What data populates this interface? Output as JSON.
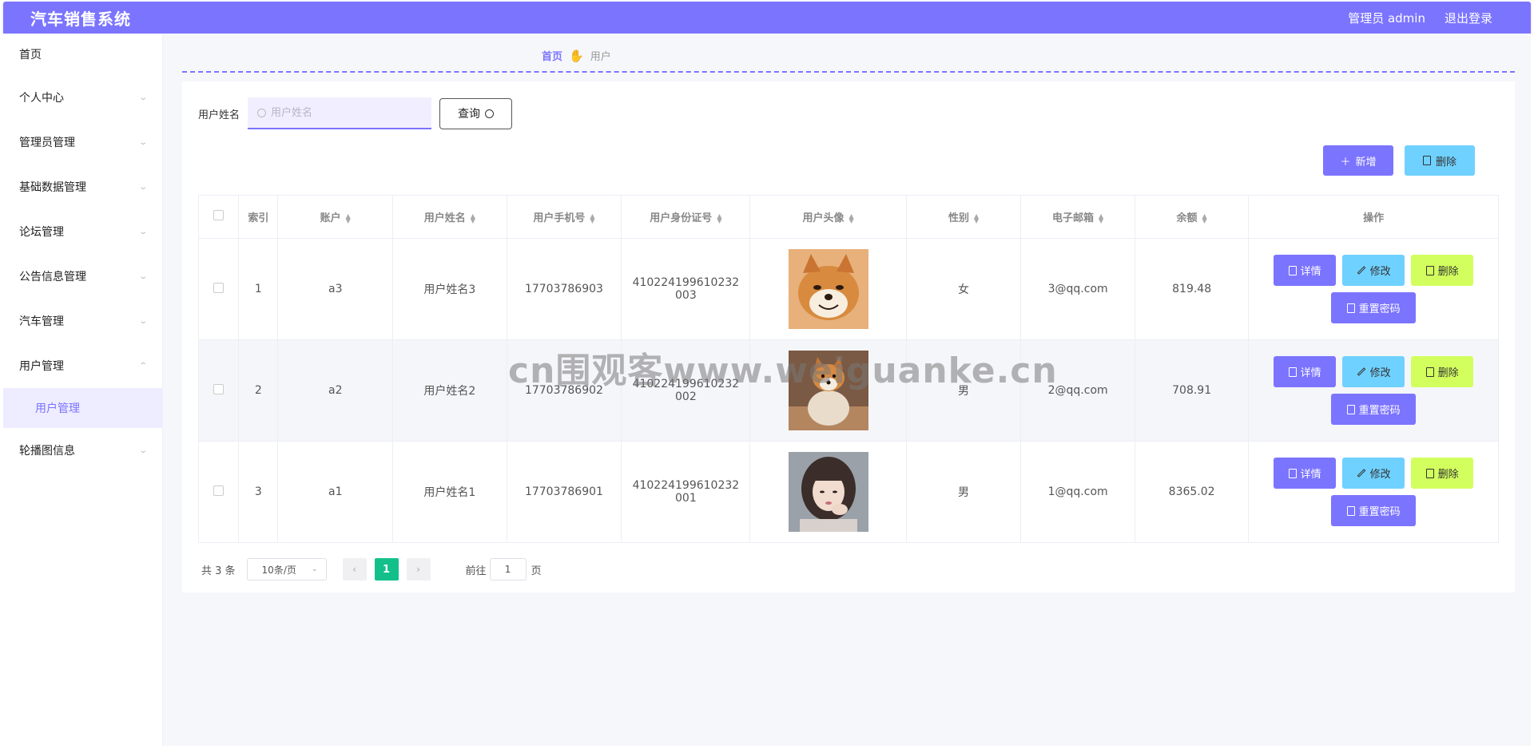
{
  "header": {
    "title": "汽车销售系统",
    "user_label": "管理员 admin",
    "logout_label": "退出登录"
  },
  "sidebar": {
    "items": [
      {
        "label": "首页"
      },
      {
        "label": "个人中心"
      },
      {
        "label": "管理员管理"
      },
      {
        "label": "基础数据管理"
      },
      {
        "label": "论坛管理"
      },
      {
        "label": "公告信息管理"
      },
      {
        "label": "汽车管理"
      },
      {
        "label": "用户管理",
        "sub": "用户管理"
      },
      {
        "label": "轮播图信息"
      }
    ]
  },
  "breadcrumb": {
    "home": "首页",
    "sep_icon": "hand-icon",
    "current": "用户"
  },
  "search": {
    "label": "用户姓名",
    "placeholder": "用户姓名",
    "button": "查询"
  },
  "actions": {
    "add": "新增",
    "delete": "删除"
  },
  "table": {
    "headers": [
      "索引",
      "账户",
      "用户姓名",
      "用户手机号",
      "用户身份证号",
      "用户头像",
      "性别",
      "电子邮箱",
      "余额",
      "操作"
    ],
    "rows": [
      {
        "index": "1",
        "account": "a3",
        "name": "用户姓名3",
        "phone": "17703786903",
        "idcard_a": "410224199610232",
        "idcard_b": "003",
        "avatar": "shiba-smile",
        "gender": "女",
        "email": "3@qq.com",
        "balance": "819.48"
      },
      {
        "index": "2",
        "account": "a2",
        "name": "用户姓名2",
        "phone": "17703786902",
        "idcard_a": "410224199610232",
        "idcard_b": "002",
        "avatar": "shiba-sit",
        "gender": "男",
        "email": "2@qq.com",
        "balance": "708.91"
      },
      {
        "index": "3",
        "account": "a1",
        "name": "用户姓名1",
        "phone": "17703786901",
        "idcard_a": "410224199610232",
        "idcard_b": "001",
        "avatar": "girl-portrait",
        "gender": "男",
        "email": "1@qq.com",
        "balance": "8365.02"
      }
    ],
    "ops": {
      "detail": "详情",
      "edit": "修改",
      "delete": "删除",
      "reset": "重置密码"
    }
  },
  "pager": {
    "total": "共 3 条",
    "size": "10条/页",
    "current_page": "1",
    "goto_label": "前往",
    "goto_value": "1",
    "page_suffix": "页"
  },
  "watermark": "cn围观客www.weiguanke.cn",
  "colors": {
    "primary": "#7b74ff",
    "cyan": "#6fd1ff",
    "lime": "#d2ff5e",
    "page_green": "#13c08a"
  }
}
